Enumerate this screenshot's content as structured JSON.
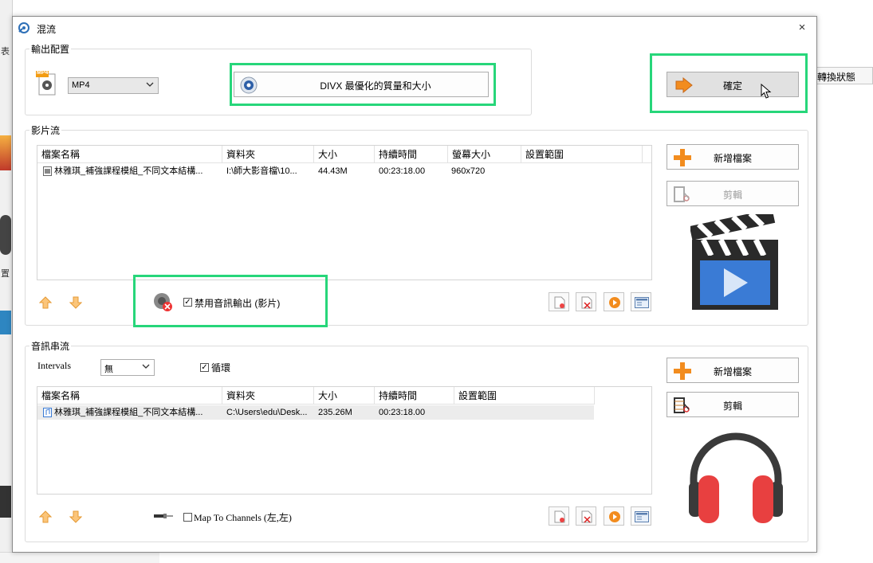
{
  "window": {
    "title": "混流",
    "close_symbol": "×"
  },
  "background": {
    "right_button": "轉換狀態",
    "left_frag_1": "表",
    "left_frag_2": "置"
  },
  "output": {
    "group_label": "輸出配置",
    "format": "MP4",
    "format_icon_badge": "MP4",
    "profile_label": "DIVX 最優化的質量和大小",
    "confirm_label": "確定"
  },
  "video": {
    "group_label": "影片流",
    "columns": [
      "檔案名稱",
      "資料夾",
      "大小",
      "持續時間",
      "螢幕大小",
      "設置範圍"
    ],
    "rows": [
      {
        "name": "林雅琪_補強課程模組_不同文本結構...",
        "folder": "I:\\師大影音檔\\10...",
        "size": "44.43M",
        "duration": "00:23:18.00",
        "screen": "960x720",
        "range": ""
      }
    ],
    "add_file_label": "新增檔案",
    "clip_label": "剪輯",
    "disable_audio_label": "禁用音訊輸出 (影片)"
  },
  "audio": {
    "group_label": "音訊串流",
    "intervals_label": "Intervals",
    "intervals_value": "無",
    "loop_label": "循環",
    "columns": [
      "檔案名稱",
      "資料夾",
      "大小",
      "持續時間",
      "設置範圍"
    ],
    "rows": [
      {
        "name": "林雅琪_補強課程模組_不同文本結構...",
        "folder": "C:\\Users\\edu\\Desk...",
        "size": "235.26M",
        "duration": "00:23:18.00",
        "range": ""
      }
    ],
    "add_file_label": "新增檔案",
    "clip_label": "剪輯",
    "map_channels_label": "Map To Channels (左,左)"
  },
  "colors": {
    "highlight": "#27d67a",
    "plus": "#f28c1e",
    "headphone_red": "#e84040"
  }
}
